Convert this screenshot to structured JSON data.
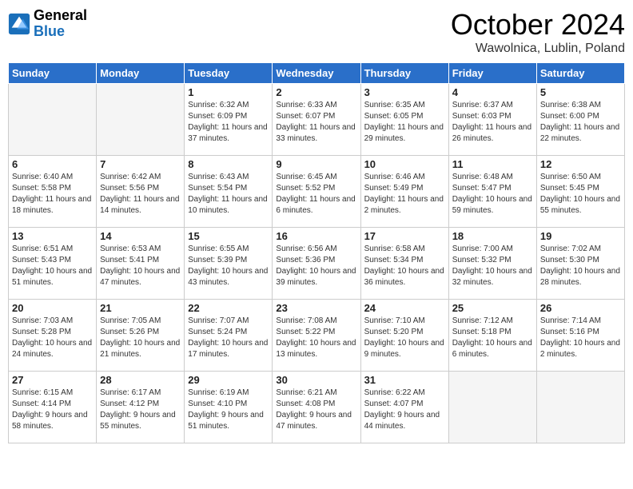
{
  "logo": {
    "line1": "General",
    "line2": "Blue"
  },
  "title": "October 2024",
  "location": "Wawolnica, Lublin, Poland",
  "days_of_week": [
    "Sunday",
    "Monday",
    "Tuesday",
    "Wednesday",
    "Thursday",
    "Friday",
    "Saturday"
  ],
  "weeks": [
    [
      {
        "num": "",
        "empty": true
      },
      {
        "num": "",
        "empty": true
      },
      {
        "num": "1",
        "sunrise": "6:32 AM",
        "sunset": "6:09 PM",
        "daylight": "11 hours and 37 minutes."
      },
      {
        "num": "2",
        "sunrise": "6:33 AM",
        "sunset": "6:07 PM",
        "daylight": "11 hours and 33 minutes."
      },
      {
        "num": "3",
        "sunrise": "6:35 AM",
        "sunset": "6:05 PM",
        "daylight": "11 hours and 29 minutes."
      },
      {
        "num": "4",
        "sunrise": "6:37 AM",
        "sunset": "6:03 PM",
        "daylight": "11 hours and 26 minutes."
      },
      {
        "num": "5",
        "sunrise": "6:38 AM",
        "sunset": "6:00 PM",
        "daylight": "11 hours and 22 minutes."
      }
    ],
    [
      {
        "num": "6",
        "sunrise": "6:40 AM",
        "sunset": "5:58 PM",
        "daylight": "11 hours and 18 minutes."
      },
      {
        "num": "7",
        "sunrise": "6:42 AM",
        "sunset": "5:56 PM",
        "daylight": "11 hours and 14 minutes."
      },
      {
        "num": "8",
        "sunrise": "6:43 AM",
        "sunset": "5:54 PM",
        "daylight": "11 hours and 10 minutes."
      },
      {
        "num": "9",
        "sunrise": "6:45 AM",
        "sunset": "5:52 PM",
        "daylight": "11 hours and 6 minutes."
      },
      {
        "num": "10",
        "sunrise": "6:46 AM",
        "sunset": "5:49 PM",
        "daylight": "11 hours and 2 minutes."
      },
      {
        "num": "11",
        "sunrise": "6:48 AM",
        "sunset": "5:47 PM",
        "daylight": "10 hours and 59 minutes."
      },
      {
        "num": "12",
        "sunrise": "6:50 AM",
        "sunset": "5:45 PM",
        "daylight": "10 hours and 55 minutes."
      }
    ],
    [
      {
        "num": "13",
        "sunrise": "6:51 AM",
        "sunset": "5:43 PM",
        "daylight": "10 hours and 51 minutes."
      },
      {
        "num": "14",
        "sunrise": "6:53 AM",
        "sunset": "5:41 PM",
        "daylight": "10 hours and 47 minutes."
      },
      {
        "num": "15",
        "sunrise": "6:55 AM",
        "sunset": "5:39 PM",
        "daylight": "10 hours and 43 minutes."
      },
      {
        "num": "16",
        "sunrise": "6:56 AM",
        "sunset": "5:36 PM",
        "daylight": "10 hours and 39 minutes."
      },
      {
        "num": "17",
        "sunrise": "6:58 AM",
        "sunset": "5:34 PM",
        "daylight": "10 hours and 36 minutes."
      },
      {
        "num": "18",
        "sunrise": "7:00 AM",
        "sunset": "5:32 PM",
        "daylight": "10 hours and 32 minutes."
      },
      {
        "num": "19",
        "sunrise": "7:02 AM",
        "sunset": "5:30 PM",
        "daylight": "10 hours and 28 minutes."
      }
    ],
    [
      {
        "num": "20",
        "sunrise": "7:03 AM",
        "sunset": "5:28 PM",
        "daylight": "10 hours and 24 minutes."
      },
      {
        "num": "21",
        "sunrise": "7:05 AM",
        "sunset": "5:26 PM",
        "daylight": "10 hours and 21 minutes."
      },
      {
        "num": "22",
        "sunrise": "7:07 AM",
        "sunset": "5:24 PM",
        "daylight": "10 hours and 17 minutes."
      },
      {
        "num": "23",
        "sunrise": "7:08 AM",
        "sunset": "5:22 PM",
        "daylight": "10 hours and 13 minutes."
      },
      {
        "num": "24",
        "sunrise": "7:10 AM",
        "sunset": "5:20 PM",
        "daylight": "10 hours and 9 minutes."
      },
      {
        "num": "25",
        "sunrise": "7:12 AM",
        "sunset": "5:18 PM",
        "daylight": "10 hours and 6 minutes."
      },
      {
        "num": "26",
        "sunrise": "7:14 AM",
        "sunset": "5:16 PM",
        "daylight": "10 hours and 2 minutes."
      }
    ],
    [
      {
        "num": "27",
        "sunrise": "6:15 AM",
        "sunset": "4:14 PM",
        "daylight": "9 hours and 58 minutes."
      },
      {
        "num": "28",
        "sunrise": "6:17 AM",
        "sunset": "4:12 PM",
        "daylight": "9 hours and 55 minutes."
      },
      {
        "num": "29",
        "sunrise": "6:19 AM",
        "sunset": "4:10 PM",
        "daylight": "9 hours and 51 minutes."
      },
      {
        "num": "30",
        "sunrise": "6:21 AM",
        "sunset": "4:08 PM",
        "daylight": "9 hours and 47 minutes."
      },
      {
        "num": "31",
        "sunrise": "6:22 AM",
        "sunset": "4:07 PM",
        "daylight": "9 hours and 44 minutes."
      },
      {
        "num": "",
        "empty": true
      },
      {
        "num": "",
        "empty": true
      }
    ]
  ]
}
